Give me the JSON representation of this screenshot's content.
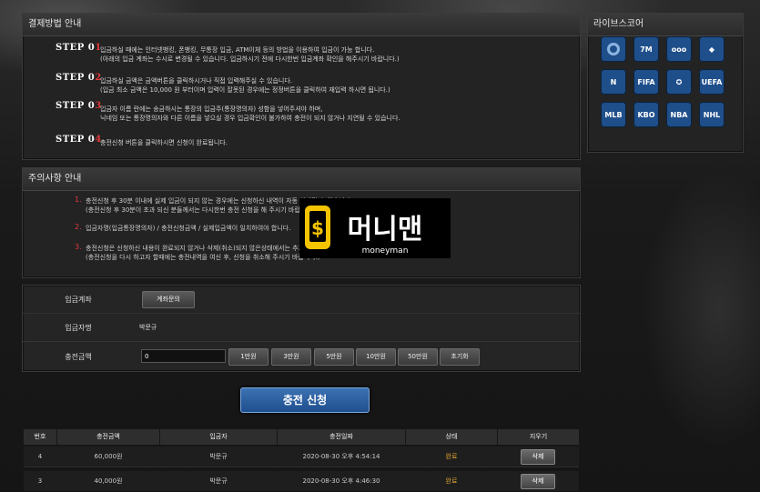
{
  "payment_guide": {
    "title": "결제방법 안내",
    "steps": [
      {
        "label": "STEP 0",
        "num": "1",
        "lines": [
          "입금하실 때에는 인터넷뱅킹, 폰뱅킹, 무통장 입금, ATM이체 등의 방법을 이용하여 입금이 가능 합니다.",
          "(아래의 입금 계좌는 수시로 변경될 수 있습니다. 입금하시기 전에 다시한번 입금계좌 확인을 해주시기 바랍니다.)"
        ]
      },
      {
        "label": "STEP 0",
        "num": "2",
        "lines": [
          "입금하실 금액은 금액버튼을 클릭하시거나 직접 입력해주실 수 있습니다.",
          "(입금 최소 금액은 10,000 원 부터이며 입력이 잘못된 경우에는 정정버튼을 클릭하여 재입력 하시면 됩니다.)"
        ]
      },
      {
        "label": "STEP 0",
        "num": "3",
        "lines": [
          "입금자 이름 란에는 송금하시는 통장의 입금주(통장명의자) 성함을 넣어주셔야 하며,",
          "닉네임 또는 통장명의자와 다른 이름을 넣으실 경우 입금확인이 불가하여 충전이 되지 않거나 지연될 수 있습니다."
        ]
      },
      {
        "label": "STEP 0",
        "num": "4",
        "lines": [
          "충전신청 버튼을 클릭하시면 신청이 완료됩니다."
        ]
      }
    ]
  },
  "notice": {
    "title": "주의사항 안내",
    "items": [
      {
        "num": "1.",
        "lines": [
          "충전신청 후 30분 이내에 실제 입금이 되지 않는 경우에는 신청하신 내역이 자동 삭제될 수 있습니다.",
          "(충전신청 후 30분이 초과 되신 분들께서는 다시한번 충전 신청을 해 주시기 바랍니다.)"
        ]
      },
      {
        "num": "2.",
        "lines": [
          "입금자명(입금통장명의자) / 충전신청금액 / 실제입금액이 일치하여야 합니다."
        ]
      },
      {
        "num": "3.",
        "lines": [
          "충전신청은 신청하신 내용이 완료되지 않거나 삭제(취소)되지 않은상태에서는 추가 신청이 불가합니다.",
          "(충전신청을 다시 하고자 할때에는 충전내역을 여신 후, 신청을 취소해 주시기 바랍니다.)"
        ]
      }
    ]
  },
  "banner": {
    "title": "머니맨",
    "subtitle": "moneyman",
    "colors": {
      "bg": "#000000",
      "accent": "#f5c400"
    }
  },
  "form": {
    "account_label": "입금계좌",
    "account_button": "계좌문의",
    "depositor_label": "입금자명",
    "depositor_value": "박문규",
    "amount_label": "충전금액",
    "amount_value": "0",
    "amount_buttons": [
      "1만원",
      "3만원",
      "5만원",
      "10만원",
      "50만원",
      "초기화"
    ]
  },
  "submit_label": "충전 신청",
  "history": {
    "headers": [
      "번호",
      "충전금액",
      "입금자",
      "충전일짜",
      "상태",
      "지우기"
    ],
    "rows": [
      {
        "no": "4",
        "amount": "60,000원",
        "name": "박문규",
        "date": "2020-08-30 오후 4:54:14",
        "status": "완료",
        "action": "삭제"
      },
      {
        "no": "3",
        "amount": "40,000원",
        "name": "박문규",
        "date": "2020-08-30 오후 4:46:30",
        "status": "완료",
        "action": "삭제"
      }
    ]
  },
  "livescore": {
    "title": "라이브스코어",
    "icons": [
      {
        "name": "livescore-circle-icon",
        "label": ""
      },
      {
        "name": "7m-icon",
        "label": "7M"
      },
      {
        "name": "goal-icon",
        "label": "ooo"
      },
      {
        "name": "diamond-icon",
        "label": "◆"
      },
      {
        "name": "naver-icon",
        "label": "N"
      },
      {
        "name": "fifa-icon",
        "label": "FIFA"
      },
      {
        "name": "champions-league-icon",
        "label": "✪"
      },
      {
        "name": "uefa-icon",
        "label": "UEFA"
      },
      {
        "name": "mlb-icon",
        "label": "MLB"
      },
      {
        "name": "kbo-icon",
        "label": "KBO"
      },
      {
        "name": "nba-icon",
        "label": "NBA"
      },
      {
        "name": "nhl-icon",
        "label": "NHL"
      }
    ]
  },
  "colors": {
    "step_num": "#e2383a",
    "status_done": "#e0a330",
    "submit": "#2a5f9f"
  }
}
